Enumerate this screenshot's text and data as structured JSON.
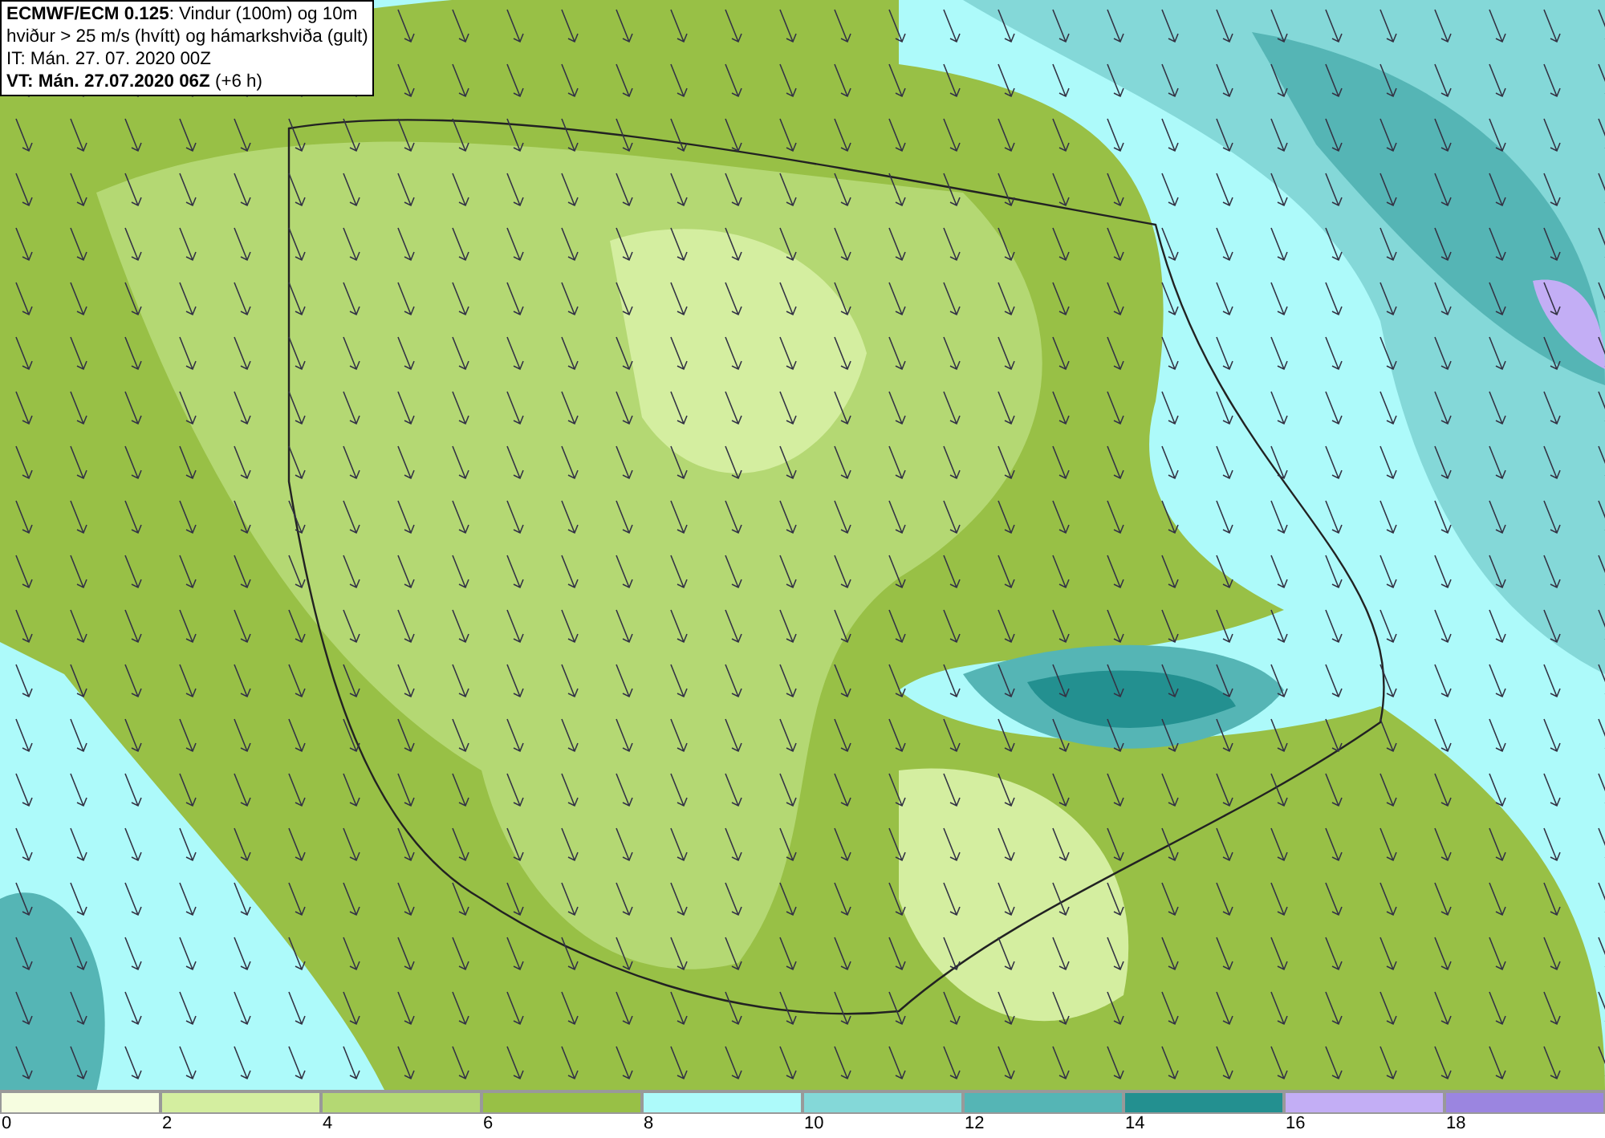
{
  "header": {
    "lines": [
      "**ECMWF/ECM 0.125**: Vindur (100m) og 10m",
      "hviður > 25 m/s (hvítt) og hámarkshviða (gult)",
      "IT: Mán. 27. 07. 2020 00Z",
      "**VT: Mán. 27.07.2020 06Z** (+6 h)"
    ]
  },
  "legend": {
    "items": [
      {
        "label": "0",
        "color": "#f6fde0"
      },
      {
        "label": "2",
        "color": "#d4eea0"
      },
      {
        "label": "4",
        "color": "#b4d873"
      },
      {
        "label": "6",
        "color": "#98c046"
      },
      {
        "label": "8",
        "color": "#adfafa"
      },
      {
        "label": "10",
        "color": "#84d8d8"
      },
      {
        "label": "12",
        "color": "#55b5b5"
      },
      {
        "label": "14",
        "color": "#239090"
      },
      {
        "label": "16",
        "color": "#c3aef5"
      },
      {
        "label": "18",
        "color": "#9b85e0"
      }
    ]
  }
}
